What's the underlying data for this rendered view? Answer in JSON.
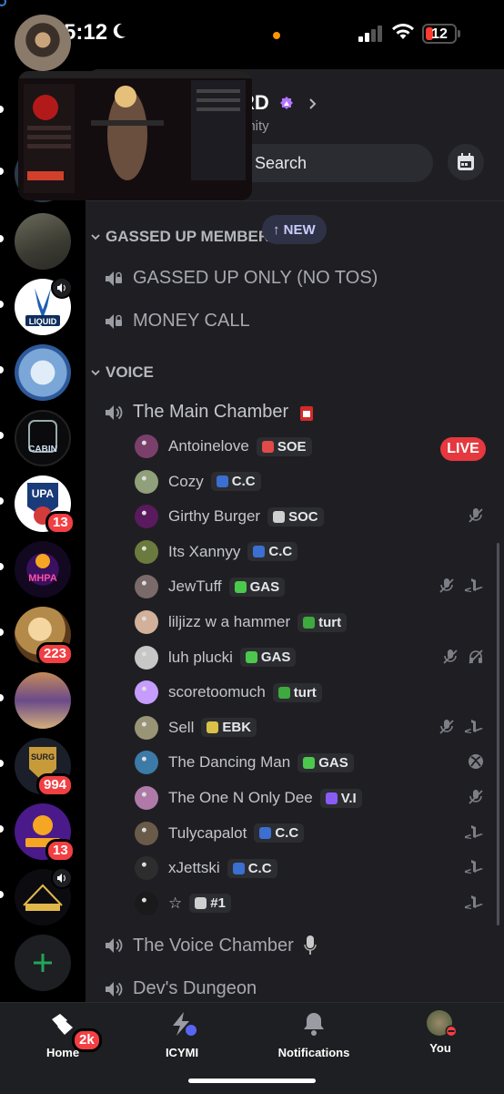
{
  "status_bar": {
    "time": "5:12",
    "battery": "12"
  },
  "rail": {
    "badges": {
      "upa": "13",
      "kai": "223",
      "surg": "994",
      "hbf": "13"
    }
  },
  "server": {
    "title_partial": "RD",
    "subtitle_partial": "unity",
    "search_label": "Search"
  },
  "categories": {
    "gassed_up": "GASSED UP MEMBER",
    "voice": "VOICE"
  },
  "new_pill": "↑ NEW",
  "gassed_channels": [
    "GASSED UP ONLY (NO TOS)",
    "MONEY CALL"
  ],
  "voice_channels": {
    "main": "The Main Chamber",
    "voice": "The Voice Chamber",
    "dungeon": "Dev's Dungeon"
  },
  "live_label": "LIVE",
  "members": [
    {
      "name": "Antoinelove",
      "tag": "SOE",
      "tag_color": "#e24a4a",
      "avatar": "#7b3f6b",
      "icons": []
    },
    {
      "name": "Cozy",
      "tag": "C.C",
      "tag_color": "#3b6fd1",
      "avatar": "#8fa07a",
      "icons": []
    },
    {
      "name": "Girthy Burger",
      "tag": "SOC",
      "tag_color": "#cfcfcf",
      "avatar": "#5a1a5e",
      "icons": [
        "muted"
      ]
    },
    {
      "name": "Its Xannyy",
      "tag": "C.C",
      "tag_color": "#3b6fd1",
      "avatar": "#6b7b3d",
      "icons": []
    },
    {
      "name": "JewTuff",
      "tag": "GAS",
      "tag_color": "#4cc94c",
      "avatar": "#7a6a6a",
      "icons": [
        "muted",
        "playstation"
      ]
    },
    {
      "name": "liljizz w a hammer",
      "tag": "turt",
      "tag_color": "#3ea93e",
      "avatar": "#d2b09a",
      "icons": []
    },
    {
      "name": "luh plucki",
      "tag": "GAS",
      "tag_color": "#4cc94c",
      "avatar": "#c7c7c7",
      "icons": [
        "muted",
        "deafened"
      ]
    },
    {
      "name": "scoretoomuch",
      "tag": "turt",
      "tag_color": "#3ea93e",
      "avatar": "#c69cff",
      "icons": []
    },
    {
      "name": "Sell",
      "tag": "EBK",
      "tag_color": "#d9c14a",
      "avatar": "#9a9477",
      "icons": [
        "muted",
        "playstation"
      ]
    },
    {
      "name": "The Dancing Man",
      "tag": "GAS",
      "tag_color": "#4cc94c",
      "avatar": "#3c7aa8",
      "icons": [
        "xbox"
      ]
    },
    {
      "name": "The One N Only Dee",
      "tag": "V.I",
      "tag_color": "#8a5cf6",
      "avatar": "#b07aa8",
      "icons": [
        "muted"
      ]
    },
    {
      "name": "Tulycapalot",
      "tag": "C.C",
      "tag_color": "#3b6fd1",
      "avatar": "#6a5a4a",
      "icons": [
        "playstation"
      ]
    },
    {
      "name": "xJettski",
      "tag": "C.C",
      "tag_color": "#3b6fd1",
      "avatar": "#2d2d2d",
      "icons": [
        "playstation"
      ]
    },
    {
      "name": "☆",
      "tag": "#1",
      "tag_color": "#cfcfcf",
      "avatar": "#1a1a1a",
      "icons": [
        "playstation"
      ]
    }
  ],
  "bottom_tabs": {
    "home": "Home",
    "home_badge": "2k",
    "icymi": "ICYMI",
    "notifications": "Notifications",
    "you": "You"
  },
  "colors": {
    "accent": "#5865f2",
    "danger": "#f23f43",
    "live": "#e5393f",
    "online": "#23a55a"
  }
}
